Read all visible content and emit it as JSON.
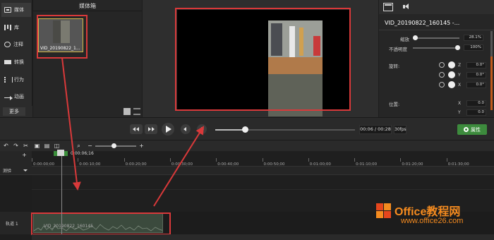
{
  "sidebar": {
    "items": [
      {
        "label": "媒体",
        "icon": "media-icon"
      },
      {
        "label": "库",
        "icon": "library-icon"
      },
      {
        "label": "注释",
        "icon": "annotation-icon"
      },
      {
        "label": "转换",
        "icon": "transition-icon"
      },
      {
        "label": "行为",
        "icon": "behavior-icon"
      },
      {
        "label": "动画",
        "icon": "animation-icon"
      }
    ],
    "more_label": "更多",
    "add_label": "+"
  },
  "media_bin": {
    "title": "媒体箱",
    "item_label": "VID_20190822_1..."
  },
  "properties": {
    "clip_name": "VID_20190822_160145 -...",
    "scale_label": "缩放",
    "scale_value": "28.1%",
    "scale_level": 0.0,
    "opacity_label": "不透明度",
    "opacity_value": "100%",
    "opacity_level": 1.0,
    "rotation_label": "旋转:",
    "rotation": [
      {
        "axis": "Z",
        "value": "0.0°"
      },
      {
        "axis": "Y",
        "value": "0.0°"
      },
      {
        "axis": "X",
        "value": "0.0°"
      }
    ],
    "position_label": "位置:",
    "position": [
      {
        "axis": "X",
        "value": "0.0"
      },
      {
        "axis": "Y",
        "value": "0.0"
      }
    ]
  },
  "transport": {
    "time_display": "00:06 / 00:28",
    "fps": "30fps",
    "progress": 0.21,
    "properties_button": "属性"
  },
  "timeline": {
    "zoom_level": 0.45,
    "playhead_time": "0:00:06;16",
    "ticks": [
      "0:00:00;00",
      "0:00:10;00",
      "0:00:20;00",
      "0:00:30;00",
      "0:00:40;00",
      "0:00:50;00",
      "0:01:00;00",
      "0:01:10;00",
      "0:01:20;00",
      "0:01:30;00"
    ],
    "marker_label": "测验",
    "track_label": "轨道 1",
    "clip_label": "VID_20190822_160145"
  },
  "logo": {
    "title": "Office教程网",
    "url": "www.office26.com"
  },
  "colors": {
    "highlight_red": "#d9393a",
    "accent_green": "#3d8b3d",
    "logo_orange": "#f58b1f"
  }
}
